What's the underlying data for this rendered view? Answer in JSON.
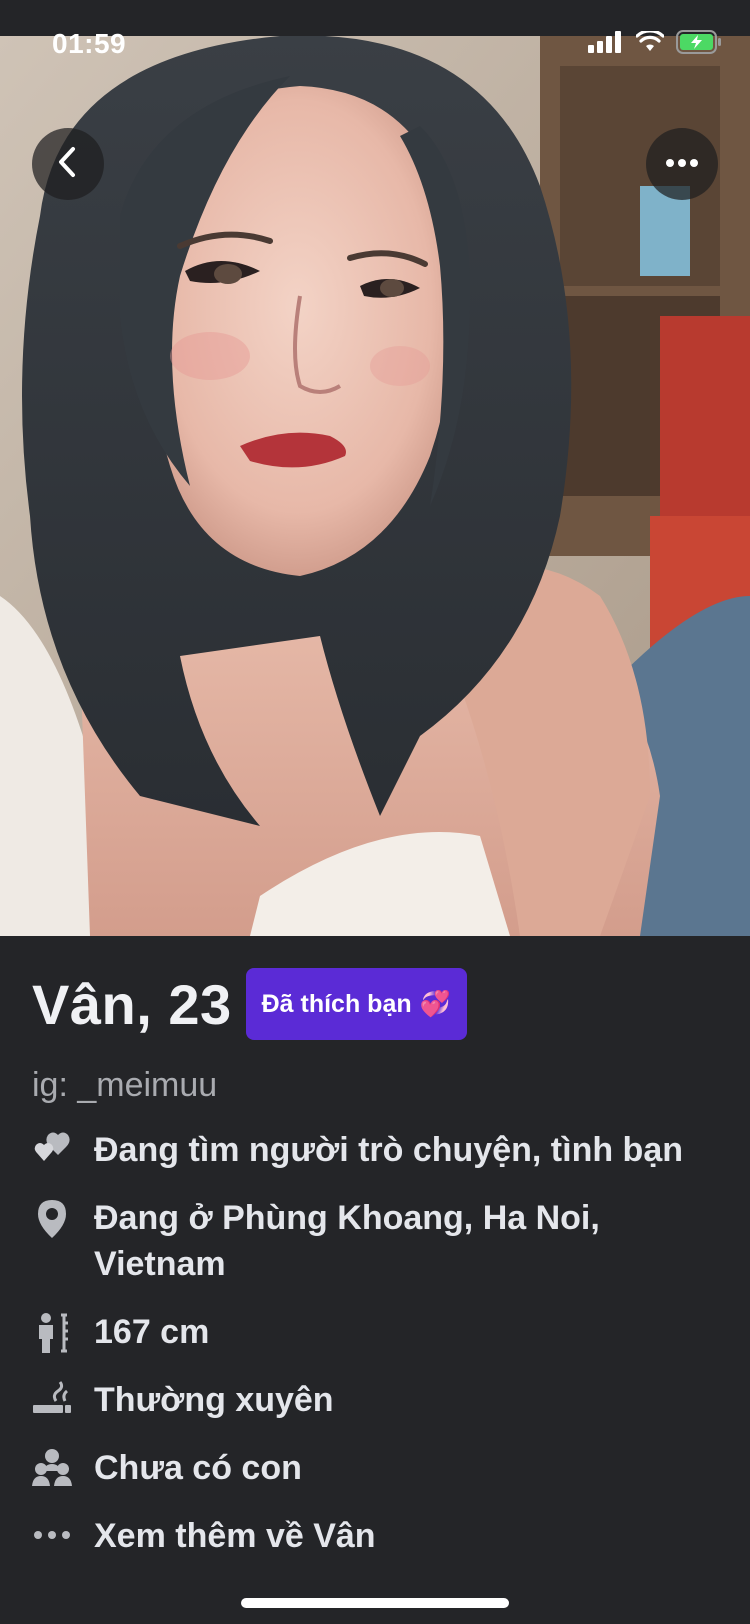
{
  "status_bar": {
    "time": "01:59"
  },
  "photo": {
    "description_icon": "profile-photo"
  },
  "profile": {
    "name_age": "Vân, 23",
    "liked_badge": "Đã thích bạn",
    "liked_badge_emoji": "💞",
    "handle": "ig: _meimuu"
  },
  "details": [
    {
      "icon": "hearts-icon",
      "text": "Đang tìm người trò chuyện, tình bạn"
    },
    {
      "icon": "location-pin-icon",
      "text": "Đang ở Phùng Khoang, Ha Noi, Vietnam"
    },
    {
      "icon": "height-icon",
      "text": "167 cm"
    },
    {
      "icon": "smoking-icon",
      "text": "Thường xuyên"
    },
    {
      "icon": "children-icon",
      "text": "Chưa có con"
    },
    {
      "icon": "more-dots-icon",
      "text": "Xem thêm về Vân"
    }
  ],
  "colors": {
    "background": "#242528",
    "badge": "#5b2bd6",
    "text": "#e4e6eb",
    "muted": "#a9abb0"
  }
}
